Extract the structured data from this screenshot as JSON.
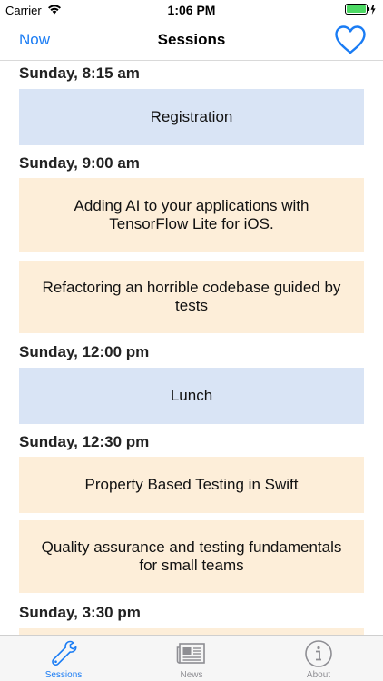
{
  "status_bar": {
    "carrier": "Carrier",
    "time": "1:06 PM",
    "wifi_icon": "wifi-icon",
    "battery_icon": "battery-charging-icon",
    "battery_color": "#4cd964"
  },
  "nav": {
    "left_button": "Now",
    "title": "Sessions",
    "right_icon": "heart-outline-icon"
  },
  "colors": {
    "accent": "#1a7cf4",
    "break_card": "#d9e4f5",
    "talk_card": "#fdeed9"
  },
  "sections": [
    {
      "header": "Sunday, 8:15 am",
      "sessions": [
        {
          "title": "Registration",
          "kind": "break"
        }
      ]
    },
    {
      "header": "Sunday, 9:00 am",
      "sessions": [
        {
          "title": "Adding AI to your applications with TensorFlow Lite for iOS.",
          "kind": "talk"
        },
        {
          "title": "Refactoring an horrible codebase guided by tests",
          "kind": "talk"
        }
      ]
    },
    {
      "header": "Sunday, 12:00 pm",
      "sessions": [
        {
          "title": "Lunch",
          "kind": "break"
        }
      ]
    },
    {
      "header": "Sunday, 12:30 pm",
      "sessions": [
        {
          "title": "Property Based Testing in Swift",
          "kind": "talk"
        },
        {
          "title": "Quality assurance and testing fundamentals for small teams",
          "kind": "talk"
        }
      ]
    },
    {
      "header": "Sunday, 3:30 pm",
      "sessions": [
        {
          "title": "",
          "kind": "talk"
        }
      ]
    }
  ],
  "tab_bar": {
    "tabs": [
      {
        "label": "Sessions",
        "icon": "wrench-icon",
        "selected": true
      },
      {
        "label": "News",
        "icon": "newspaper-icon",
        "selected": false
      },
      {
        "label": "About",
        "icon": "info-circle-icon",
        "selected": false
      }
    ]
  }
}
